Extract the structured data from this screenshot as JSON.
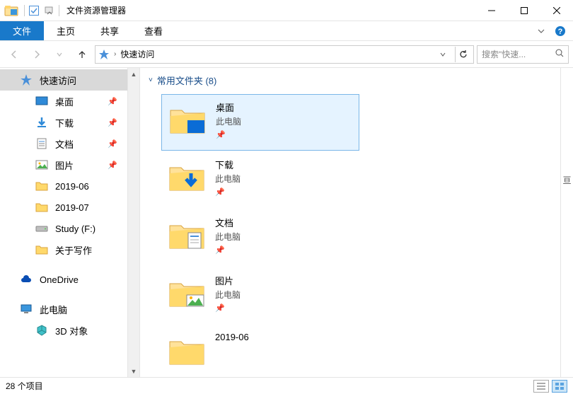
{
  "window": {
    "title": "文件资源管理器"
  },
  "ribbon": {
    "tabs": [
      "文件",
      "主页",
      "共享",
      "查看"
    ],
    "active_index": 0
  },
  "address": {
    "crumb": "快速访问"
  },
  "search": {
    "placeholder": "搜索\"快速..."
  },
  "sidebar": {
    "items": [
      {
        "label": "快速访问",
        "icon": "star",
        "level": 1,
        "pinned": false,
        "selected": true
      },
      {
        "label": "桌面",
        "icon": "desktop",
        "level": 2,
        "pinned": true
      },
      {
        "label": "下载",
        "icon": "download",
        "level": 2,
        "pinned": true
      },
      {
        "label": "文档",
        "icon": "document",
        "level": 2,
        "pinned": true
      },
      {
        "label": "图片",
        "icon": "picture",
        "level": 2,
        "pinned": true
      },
      {
        "label": "2019-06",
        "icon": "folder",
        "level": 2,
        "pinned": false
      },
      {
        "label": "2019-07",
        "icon": "folder",
        "level": 2,
        "pinned": false
      },
      {
        "label": "Study (F:)",
        "icon": "drive",
        "level": 2,
        "pinned": false
      },
      {
        "label": "关于写作",
        "icon": "folder",
        "level": 2,
        "pinned": false
      },
      {
        "spacer": true
      },
      {
        "label": "OneDrive",
        "icon": "cloud",
        "level": 1,
        "pinned": false
      },
      {
        "spacer": true
      },
      {
        "label": "此电脑",
        "icon": "pc",
        "level": 1,
        "pinned": false
      },
      {
        "label": "3D 对象",
        "icon": "3d",
        "level": 2,
        "pinned": false
      }
    ]
  },
  "group": {
    "title": "常用文件夹 (8)"
  },
  "folders": [
    {
      "name": "桌面",
      "sub": "此电脑",
      "pinned": true,
      "selected": true,
      "overlay": "desktop"
    },
    {
      "name": "下载",
      "sub": "此电脑",
      "pinned": true,
      "overlay": "download"
    },
    {
      "name": "文档",
      "sub": "此电脑",
      "pinned": true,
      "overlay": "document"
    },
    {
      "name": "图片",
      "sub": "此电脑",
      "pinned": true,
      "overlay": "picture"
    },
    {
      "name": "2019-06",
      "sub": "",
      "pinned": false,
      "overlay": "none"
    }
  ],
  "status": {
    "text": "28 个项目"
  },
  "right_edge": {
    "text": "亘"
  }
}
